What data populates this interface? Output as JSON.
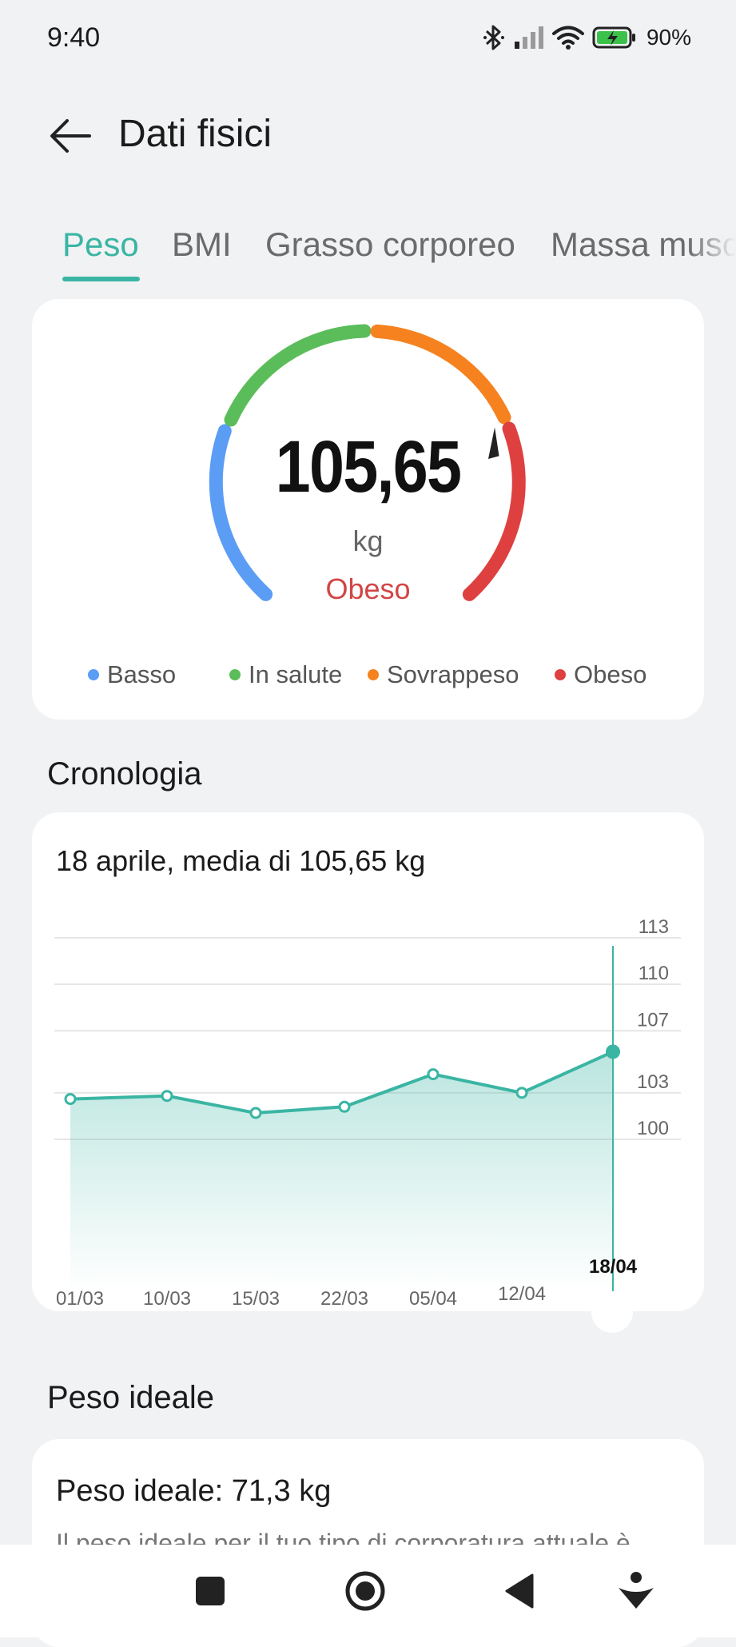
{
  "status_bar": {
    "time": "9:40",
    "battery": "90%"
  },
  "header": {
    "title": "Dati fisici"
  },
  "tabs": [
    {
      "label": "Peso",
      "active": true
    },
    {
      "label": "BMI",
      "active": false
    },
    {
      "label": "Grasso corporeo",
      "active": false
    },
    {
      "label": "Massa muscolare",
      "active": false
    }
  ],
  "gauge": {
    "value": "105,65",
    "unit": "kg",
    "status": "Obeso",
    "status_color": "#d24545",
    "segment_colors": {
      "basso": "#5b9df5",
      "in_salute": "#5bbd5a",
      "sovrappeso": "#f5821f",
      "obeso": "#de4040"
    },
    "legend": [
      {
        "label": "Basso",
        "color": "#5b9df5"
      },
      {
        "label": "In salute",
        "color": "#5bbd5a"
      },
      {
        "label": "Sovrappeso",
        "color": "#f5821f"
      },
      {
        "label": "Obeso",
        "color": "#de4040"
      }
    ]
  },
  "history": {
    "section_title": "Cronologia",
    "subtitle": "18 aprile, media di 105,65 kg"
  },
  "chart_data": {
    "type": "area",
    "title": "",
    "xlabel": "",
    "ylabel": "",
    "x": [
      "01/03",
      "10/03",
      "15/03",
      "22/03",
      "05/04",
      "12/04",
      "18/04"
    ],
    "series": [
      {
        "values": [
          102.6,
          102.8,
          101.7,
          102.1,
          104.2,
          103.0,
          105.65
        ]
      }
    ],
    "y_ticks": [
      100,
      103,
      107,
      110,
      113
    ],
    "ylim": [
      94,
      113
    ],
    "selected_index": 6,
    "selected_label": "18/04",
    "line_color": "#3ab5a3",
    "grid": true
  },
  "ideal": {
    "section_title": "Peso ideale",
    "title": "Peso ideale: 71,3 kg",
    "description": "Il peso ideale per il tuo tipo di corporatura attuale è"
  },
  "nav": {
    "icons": [
      "square-icon",
      "home-circle-icon",
      "back-triangle-icon",
      "accessibility-icon"
    ]
  }
}
